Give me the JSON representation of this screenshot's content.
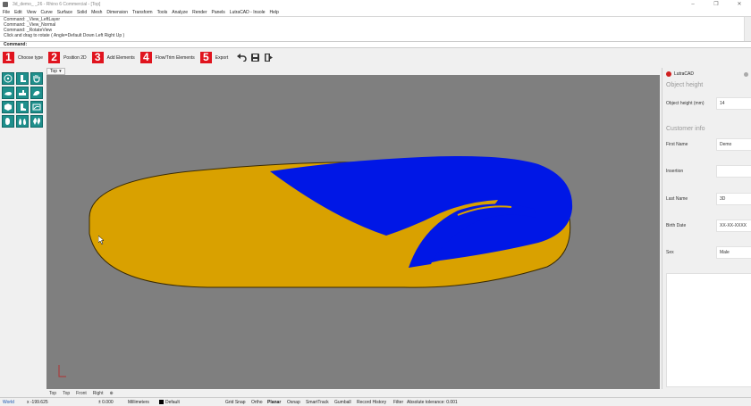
{
  "window": {
    "title": "3d_demo_ _26 - Rhino 6 Commercial - [Top]",
    "controls": [
      "–",
      "❐",
      "✕"
    ]
  },
  "menu": [
    "File",
    "Edit",
    "View",
    "Curve",
    "Surface",
    "Solid",
    "Mesh",
    "Dimension",
    "Transform",
    "Tools",
    "Analyze",
    "Render",
    "Panels",
    "LutraCAD - Insole",
    "Help"
  ],
  "command_history": [
    "Command: _View_LeftLayer",
    "Command: _View_Normal",
    "Command: _RotateView",
    "Click and drag to rotate ( Angle=Default  Down  Left  Right  Up )"
  ],
  "command_prompt": "Command:",
  "toolbar": {
    "steps": [
      {
        "num": "1",
        "label": "Choose type"
      },
      {
        "num": "2",
        "label": "Position 2D"
      },
      {
        "num": "3",
        "label": "Add Elements"
      },
      {
        "num": "4",
        "label": "Flow/Trim Elements"
      },
      {
        "num": "5",
        "label": "Export"
      }
    ],
    "icons": [
      "undo-icon",
      "save-icon",
      "exit-icon"
    ]
  },
  "viewport": {
    "label": "Top",
    "dropdown": "▾",
    "colors": {
      "background": "#7f7f7f",
      "base": "#d9a100",
      "top": "#0017e6",
      "outline": "#3a2a00"
    }
  },
  "left_tools": [
    "circle-target-icon",
    "foot-side-icon",
    "hand-icon",
    "sole-icon",
    "heel-icon",
    "foot-top-icon",
    "box-icon",
    "boot-icon",
    "scan-icon",
    "foot-icon",
    "feet-icon",
    "feet-pair-icon"
  ],
  "panel": {
    "header": "LutraCAD",
    "object_height_title": "Object height",
    "object_height_label": "Object height (mm)",
    "object_height_value": "14",
    "customer_title": "Customer info",
    "fields": [
      {
        "label": "First Name",
        "value": "Demo"
      },
      {
        "label": "Insertion",
        "value": ""
      },
      {
        "label": "Last Name",
        "value": "3D"
      },
      {
        "label": "Birth Date",
        "value": "XX-XX-XXXX"
      },
      {
        "label": "Sex",
        "value": "Male"
      }
    ]
  },
  "bottom_tabs": [
    "Top",
    "Top",
    "Front",
    "Right",
    "⊕"
  ],
  "status": {
    "cplane": "World",
    "x": "x -199.625",
    "y": "± 0.000",
    "units": "Millimeters",
    "layer": "Default",
    "toggles": [
      "Grid Snap",
      "Ortho",
      "Planar",
      "Osnap",
      "SmartTrack",
      "Gumball",
      "Record History",
      "Filter"
    ],
    "tolerance": "Absolute tolerance: 0.001"
  }
}
